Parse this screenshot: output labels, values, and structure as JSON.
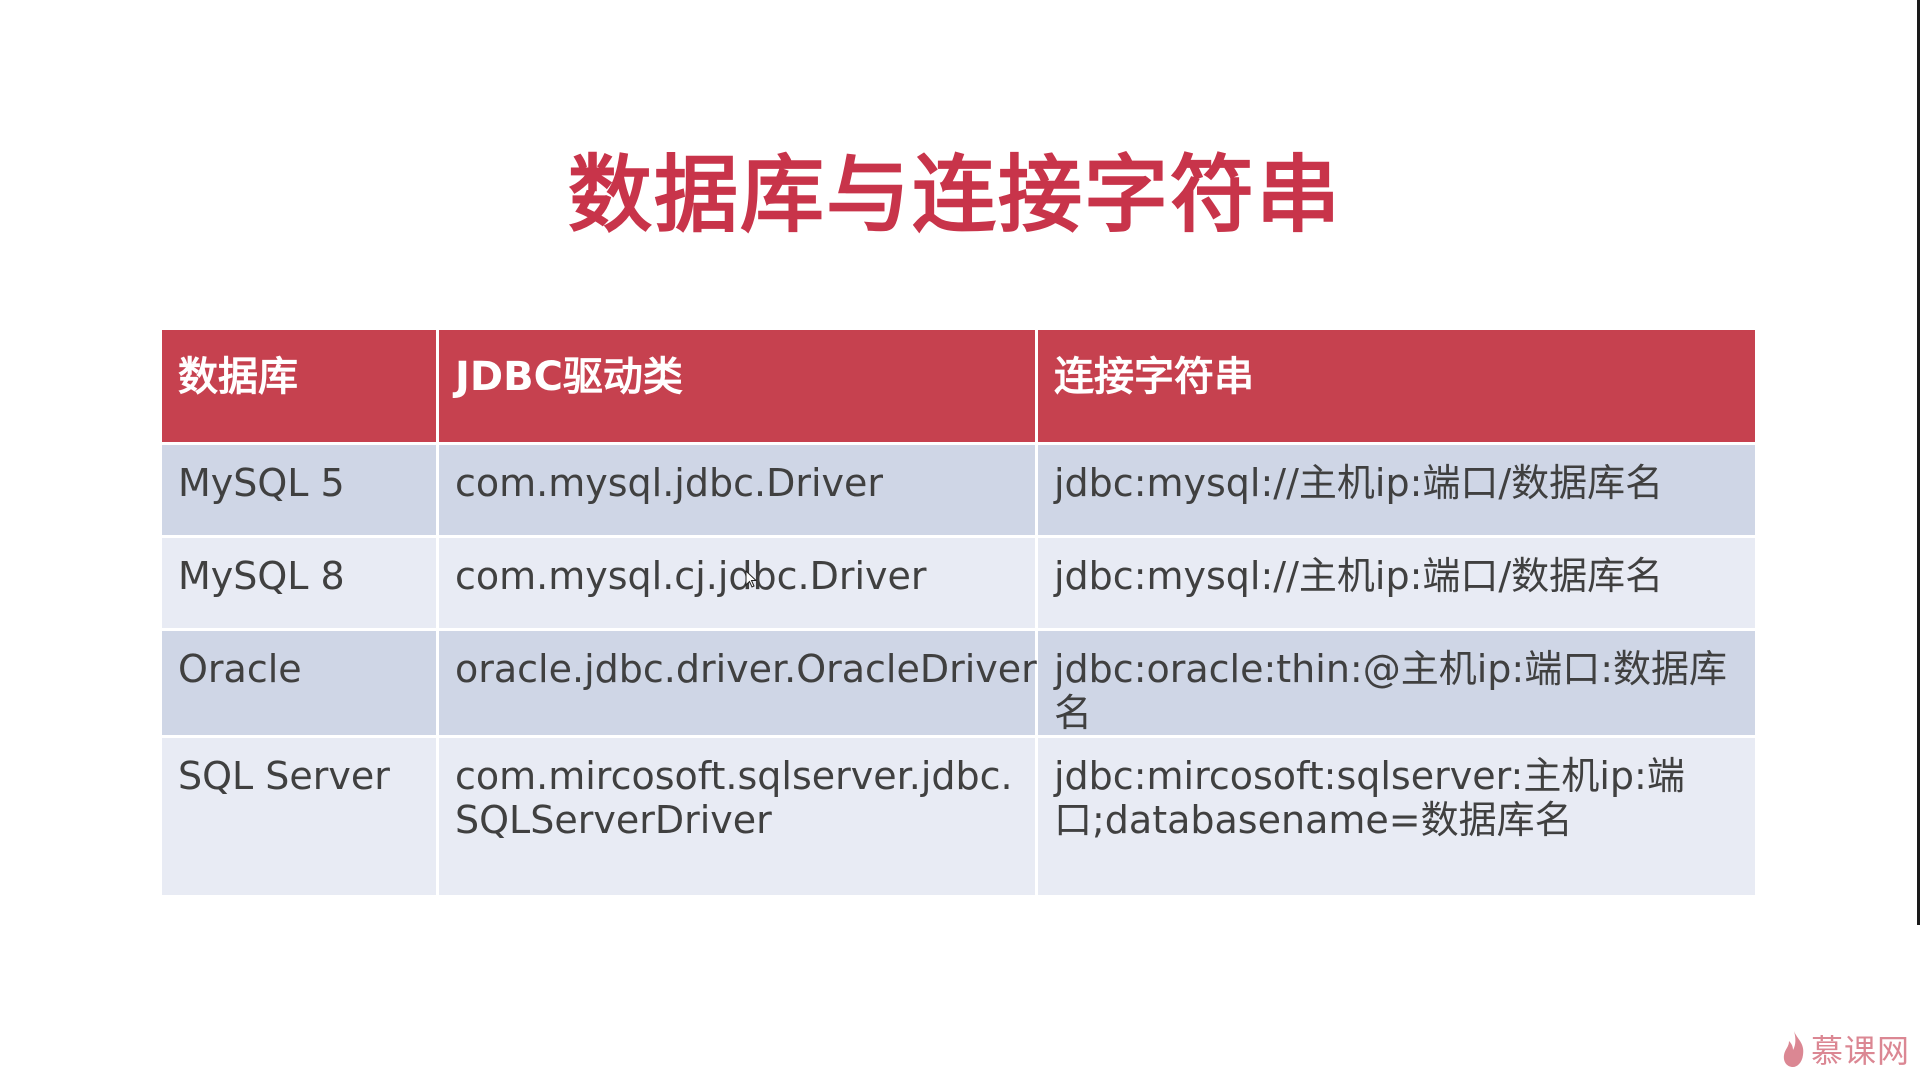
{
  "slide": {
    "title": "数据库与连接字符串",
    "accent_color": "#c8344a"
  },
  "table": {
    "headers": [
      "数据库",
      "JDBC驱动类",
      "连接字符串"
    ],
    "rows": [
      {
        "database": "MySQL 5",
        "driver": "com.mysql.jdbc.Driver",
        "connection": "jdbc:mysql://主机ip:端口/数据库名"
      },
      {
        "database": "MySQL 8",
        "driver": "com.mysql.cj.jdbc.Driver",
        "connection": "jdbc:mysql://主机ip:端口/数据库名"
      },
      {
        "database": "Oracle",
        "driver": "oracle.jdbc.driver.OracleDriver",
        "connection": "jdbc:oracle:thin:@主机ip:端口:数据库名"
      },
      {
        "database": "SQL Server",
        "driver_line1": "com.mircosoft.sqlserver.jdbc.",
        "driver_line2": "SQLServerDriver",
        "connection_line1": "jdbc:mircosoft:sqlserver:主机ip:端",
        "connection_line2": "口;databasename=数据库名"
      }
    ],
    "header_color": "#c6414f",
    "row_odd_color": "#cfd6e6",
    "row_even_color": "#e8ebf4"
  },
  "watermark": {
    "icon": "flame-icon",
    "text": "慕课网"
  }
}
